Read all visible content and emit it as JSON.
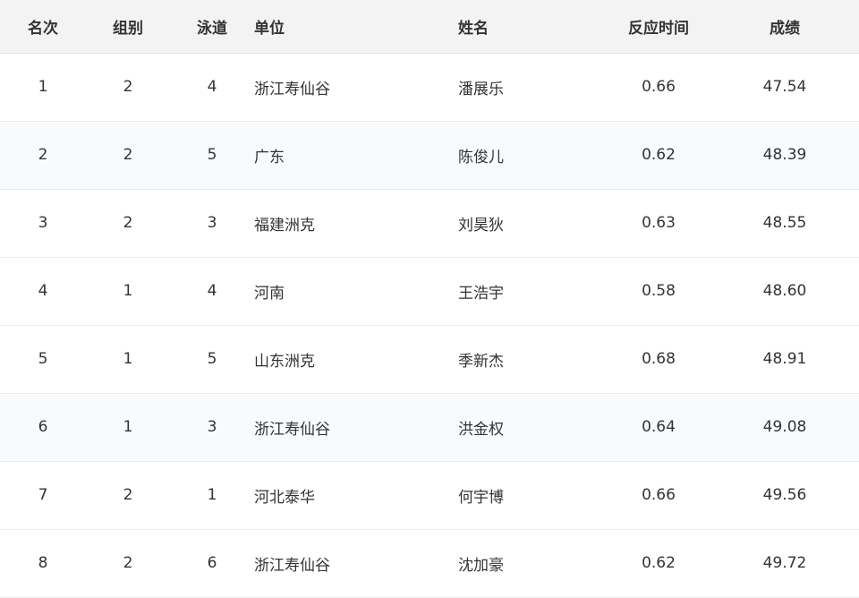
{
  "table": {
    "headers": {
      "rank": "名次",
      "group": "组别",
      "lane": "泳道",
      "unit": "单位",
      "name": "姓名",
      "reaction": "反应时间",
      "score": "成绩"
    },
    "rows": [
      {
        "rank": "1",
        "group": "2",
        "lane": "4",
        "unit": "浙江寿仙谷",
        "name": "潘展乐",
        "reaction": "0.66",
        "score": "47.54"
      },
      {
        "rank": "2",
        "group": "2",
        "lane": "5",
        "unit": "广东",
        "name": "陈俊儿",
        "reaction": "0.62",
        "score": "48.39"
      },
      {
        "rank": "3",
        "group": "2",
        "lane": "3",
        "unit": "福建洲克",
        "name": "刘昊狄",
        "reaction": "0.63",
        "score": "48.55"
      },
      {
        "rank": "4",
        "group": "1",
        "lane": "4",
        "unit": "河南",
        "name": "王浩宇",
        "reaction": "0.58",
        "score": "48.60"
      },
      {
        "rank": "5",
        "group": "1",
        "lane": "5",
        "unit": "山东洲克",
        "name": "季新杰",
        "reaction": "0.68",
        "score": "48.91"
      },
      {
        "rank": "6",
        "group": "1",
        "lane": "3",
        "unit": "浙江寿仙谷",
        "name": "洪金权",
        "reaction": "0.64",
        "score": "49.08"
      },
      {
        "rank": "7",
        "group": "2",
        "lane": "1",
        "unit": "河北泰华",
        "name": "何宇博",
        "reaction": "0.66",
        "score": "49.56"
      },
      {
        "rank": "8",
        "group": "2",
        "lane": "6",
        "unit": "浙江寿仙谷",
        "name": "沈加豪",
        "reaction": "0.62",
        "score": "49.72"
      }
    ]
  },
  "colors": {
    "header_bg": "#f3f3f3",
    "row_alt_bg": "#f8fbfd",
    "text": "#333333",
    "border": "#ececec"
  }
}
